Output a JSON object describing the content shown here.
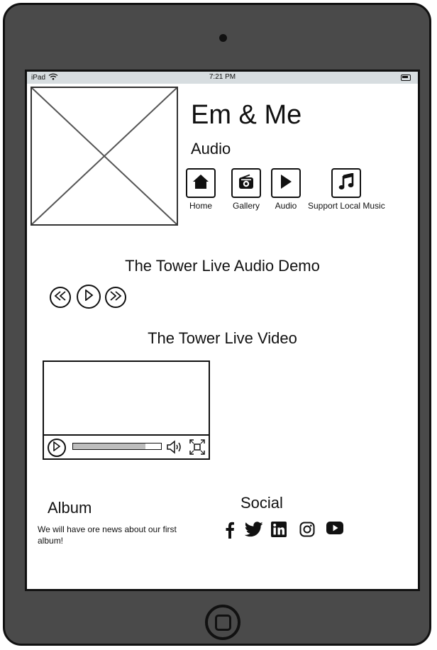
{
  "status": {
    "device": "iPad",
    "time": "7:21 PM"
  },
  "header": {
    "brand": "Em & Me",
    "page": "Audio"
  },
  "nav": {
    "items": [
      {
        "label": "Home",
        "icon": "home-icon"
      },
      {
        "label": "Gallery",
        "icon": "radio-icon"
      },
      {
        "label": "Audio",
        "icon": "play-icon"
      },
      {
        "label": "Support Local Music",
        "icon": "music-note-icon"
      }
    ]
  },
  "audio": {
    "title": "The Tower Live Audio Demo"
  },
  "video": {
    "title": "The Tower Live Video",
    "progress": 0.82
  },
  "album": {
    "title": "Album",
    "text": "We will have ore news about our first album!"
  },
  "social": {
    "title": "Social",
    "icons": [
      "facebook-icon",
      "twitter-icon",
      "linkedin-icon",
      "instagram-icon",
      "youtube-icon"
    ]
  },
  "colors": {
    "device": "#4a4a4a",
    "statusbar": "#d7dde0",
    "progress_fill": "#bdbdbd"
  }
}
